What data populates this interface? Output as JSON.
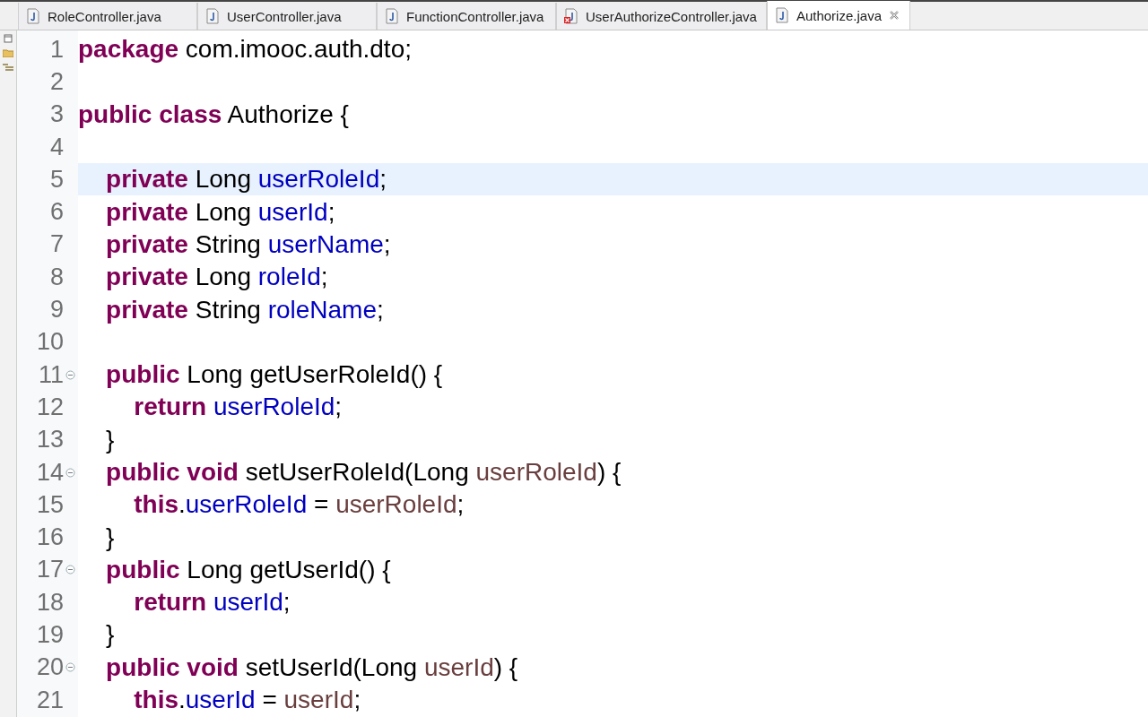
{
  "tabs": [
    {
      "label": "RoleController.java",
      "selected": false,
      "error": false
    },
    {
      "label": "UserController.java",
      "selected": false,
      "error": false
    },
    {
      "label": "FunctionController.java",
      "selected": false,
      "error": false
    },
    {
      "label": "UserAuthorizeController.java",
      "selected": false,
      "error": true
    },
    {
      "label": "Authorize.java",
      "selected": true,
      "error": false
    }
  ],
  "lines": [
    {
      "number": "1",
      "foldable": false,
      "current": false,
      "tokens": [
        {
          "kind": "keyword",
          "text": "package"
        },
        {
          "kind": "plain",
          "text": " com.imooc.auth.dto;"
        }
      ]
    },
    {
      "number": "2",
      "foldable": false,
      "current": false
    },
    {
      "number": "3",
      "foldable": false,
      "current": false,
      "tokens": [
        {
          "kind": "keyword",
          "text": "public class"
        },
        {
          "kind": "plain",
          "text": " Authorize {"
        }
      ]
    },
    {
      "number": "4",
      "foldable": false,
      "current": false
    },
    {
      "number": "5",
      "foldable": false,
      "current": true,
      "tokens": [
        {
          "kind": "keyword",
          "text": "    private"
        },
        {
          "kind": "plain",
          "text": " Long "
        },
        {
          "kind": "field",
          "text": "userRoleId"
        },
        {
          "kind": "plain",
          "text": ";"
        }
      ]
    },
    {
      "number": "6",
      "foldable": false,
      "current": false,
      "tokens": [
        {
          "kind": "keyword",
          "text": "    private"
        },
        {
          "kind": "plain",
          "text": " Long "
        },
        {
          "kind": "field",
          "text": "userId"
        },
        {
          "kind": "plain",
          "text": ";"
        }
      ]
    },
    {
      "number": "7",
      "foldable": false,
      "current": false,
      "tokens": [
        {
          "kind": "keyword",
          "text": "    private"
        },
        {
          "kind": "plain",
          "text": " String "
        },
        {
          "kind": "field",
          "text": "userName"
        },
        {
          "kind": "plain",
          "text": ";"
        }
      ]
    },
    {
      "number": "8",
      "foldable": false,
      "current": false,
      "tokens": [
        {
          "kind": "keyword",
          "text": "    private"
        },
        {
          "kind": "plain",
          "text": " Long "
        },
        {
          "kind": "field",
          "text": "roleId"
        },
        {
          "kind": "plain",
          "text": ";"
        }
      ]
    },
    {
      "number": "9",
      "foldable": false,
      "current": false,
      "tokens": [
        {
          "kind": "keyword",
          "text": "    private"
        },
        {
          "kind": "plain",
          "text": " String "
        },
        {
          "kind": "field",
          "text": "roleName"
        },
        {
          "kind": "plain",
          "text": ";"
        }
      ]
    },
    {
      "number": "10",
      "foldable": false,
      "current": false
    },
    {
      "number": "11",
      "foldable": true,
      "current": false,
      "tokens": [
        {
          "kind": "keyword",
          "text": "    public"
        },
        {
          "kind": "plain",
          "text": " Long getUserRoleId() {"
        }
      ]
    },
    {
      "number": "12",
      "foldable": false,
      "current": false,
      "tokens": [
        {
          "kind": "keyword",
          "text": "        return "
        },
        {
          "kind": "field",
          "text": "userRoleId"
        },
        {
          "kind": "plain",
          "text": ";"
        }
      ]
    },
    {
      "number": "13",
      "foldable": false,
      "current": false,
      "tokens": [
        {
          "kind": "plain",
          "text": "    }"
        }
      ]
    },
    {
      "number": "14",
      "foldable": true,
      "current": false,
      "tokens": [
        {
          "kind": "keyword",
          "text": "    public void"
        },
        {
          "kind": "plain",
          "text": " setUserRoleId(Long "
        },
        {
          "kind": "param",
          "text": "userRoleId"
        },
        {
          "kind": "plain",
          "text": ") {"
        }
      ]
    },
    {
      "number": "15",
      "foldable": false,
      "current": false,
      "tokens": [
        {
          "kind": "keyword",
          "text": "        this"
        },
        {
          "kind": "plain",
          "text": "."
        },
        {
          "kind": "field",
          "text": "userRoleId"
        },
        {
          "kind": "plain",
          "text": " = "
        },
        {
          "kind": "param",
          "text": "userRoleId"
        },
        {
          "kind": "plain",
          "text": ";"
        }
      ]
    },
    {
      "number": "16",
      "foldable": false,
      "current": false,
      "tokens": [
        {
          "kind": "plain",
          "text": "    }"
        }
      ]
    },
    {
      "number": "17",
      "foldable": true,
      "current": false,
      "tokens": [
        {
          "kind": "keyword",
          "text": "    public"
        },
        {
          "kind": "plain",
          "text": " Long getUserId() {"
        }
      ]
    },
    {
      "number": "18",
      "foldable": false,
      "current": false,
      "tokens": [
        {
          "kind": "keyword",
          "text": "        return "
        },
        {
          "kind": "field",
          "text": "userId"
        },
        {
          "kind": "plain",
          "text": ";"
        }
      ]
    },
    {
      "number": "19",
      "foldable": false,
      "current": false,
      "tokens": [
        {
          "kind": "plain",
          "text": "    }"
        }
      ]
    },
    {
      "number": "20",
      "foldable": true,
      "current": false,
      "tokens": [
        {
          "kind": "keyword",
          "text": "    public void"
        },
        {
          "kind": "plain",
          "text": " setUserId(Long "
        },
        {
          "kind": "param",
          "text": "userId"
        },
        {
          "kind": "plain",
          "text": ") {"
        }
      ]
    },
    {
      "number": "21",
      "foldable": false,
      "current": false,
      "tokens": [
        {
          "kind": "keyword",
          "text": "        this"
        },
        {
          "kind": "plain",
          "text": "."
        },
        {
          "kind": "field",
          "text": "userId"
        },
        {
          "kind": "plain",
          "text": " = "
        },
        {
          "kind": "param",
          "text": "userId"
        },
        {
          "kind": "plain",
          "text": ";"
        }
      ]
    }
  ]
}
